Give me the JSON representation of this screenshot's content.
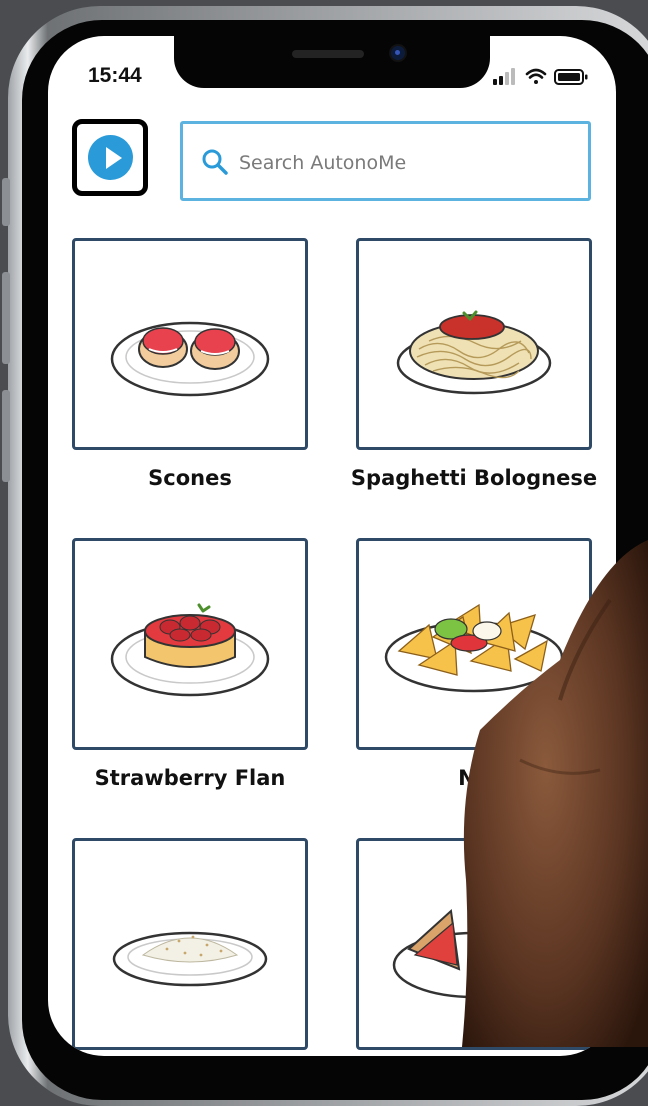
{
  "status_bar": {
    "time": "15:44"
  },
  "header": {
    "play_icon": "play-icon",
    "search": {
      "placeholder": "Search AutonoMe",
      "value": "",
      "icon": "search-icon"
    }
  },
  "recipes": [
    {
      "label": "Scones",
      "image": "scones-image"
    },
    {
      "label": "Spaghetti Bolognese",
      "image": "spaghetti-image"
    },
    {
      "label": "Strawberry Flan",
      "image": "strawberry-flan-image"
    },
    {
      "label": "Na",
      "image": "nachos-image"
    },
    {
      "label": "",
      "image": "rice-image"
    },
    {
      "label": "",
      "image": "sandwich-image"
    }
  ],
  "colors": {
    "accent": "#2a9bd8",
    "search_border": "#5db3e0",
    "card_border": "#2f4a66"
  }
}
